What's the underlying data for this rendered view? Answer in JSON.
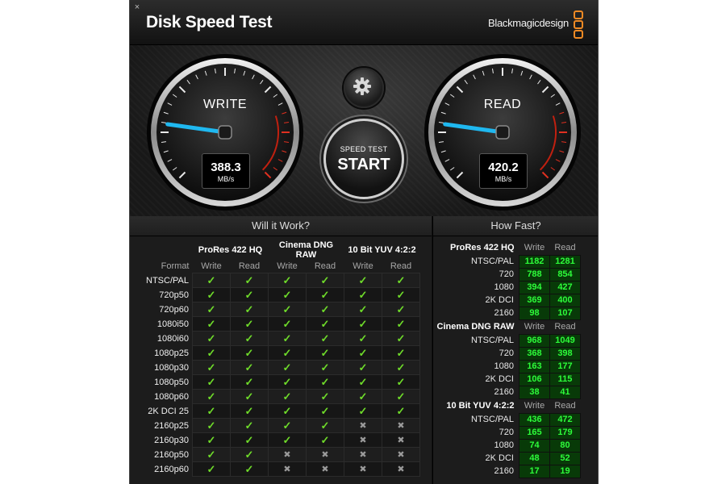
{
  "window": {
    "title": "Disk Speed Test",
    "brand": "Blackmagicdesign",
    "close_glyph": "×",
    "accent": "#f08a24"
  },
  "gauges": {
    "write": {
      "label": "WRITE",
      "value": "388.3",
      "unit": "MB/s",
      "needle_color": "#1fb8f0"
    },
    "read": {
      "label": "READ",
      "value": "420.2",
      "unit": "MB/s",
      "needle_color": "#1fb8f0"
    }
  },
  "controls": {
    "settings_icon": "gear-icon",
    "start_small": "SPEED TEST",
    "start_big": "START"
  },
  "will_it_work": {
    "title": "Will it Work?",
    "format_header": "Format",
    "groups": [
      "ProRes 422 HQ",
      "Cinema DNG RAW",
      "10 Bit YUV 4:2:2"
    ],
    "subheaders": [
      "Write",
      "Read"
    ],
    "rows": [
      {
        "format": "NTSC/PAL",
        "cells": [
          "ok",
          "ok",
          "ok",
          "ok",
          "ok",
          "ok"
        ]
      },
      {
        "format": "720p50",
        "cells": [
          "ok",
          "ok",
          "ok",
          "ok",
          "ok",
          "ok"
        ]
      },
      {
        "format": "720p60",
        "cells": [
          "ok",
          "ok",
          "ok",
          "ok",
          "ok",
          "ok"
        ]
      },
      {
        "format": "1080i50",
        "cells": [
          "ok",
          "ok",
          "ok",
          "ok",
          "ok",
          "ok"
        ]
      },
      {
        "format": "1080i60",
        "cells": [
          "ok",
          "ok",
          "ok",
          "ok",
          "ok",
          "ok"
        ]
      },
      {
        "format": "1080p25",
        "cells": [
          "ok",
          "ok",
          "ok",
          "ok",
          "ok",
          "ok"
        ]
      },
      {
        "format": "1080p30",
        "cells": [
          "ok",
          "ok",
          "ok",
          "ok",
          "ok",
          "ok"
        ]
      },
      {
        "format": "1080p50",
        "cells": [
          "ok",
          "ok",
          "ok",
          "ok",
          "ok",
          "ok"
        ]
      },
      {
        "format": "1080p60",
        "cells": [
          "ok",
          "ok",
          "ok",
          "ok",
          "ok",
          "ok"
        ]
      },
      {
        "format": "2K DCI 25",
        "cells": [
          "ok",
          "ok",
          "ok",
          "ok",
          "ok",
          "ok"
        ]
      },
      {
        "format": "2160p25",
        "cells": [
          "ok",
          "ok",
          "ok",
          "ok",
          "no",
          "no"
        ]
      },
      {
        "format": "2160p30",
        "cells": [
          "ok",
          "ok",
          "ok",
          "ok",
          "no",
          "no"
        ]
      },
      {
        "format": "2160p50",
        "cells": [
          "ok",
          "ok",
          "no",
          "no",
          "no",
          "no"
        ]
      },
      {
        "format": "2160p60",
        "cells": [
          "ok",
          "ok",
          "no",
          "no",
          "no",
          "no"
        ]
      }
    ]
  },
  "how_fast": {
    "title": "How Fast?",
    "write_header": "Write",
    "read_header": "Read",
    "groups": [
      {
        "name": "ProRes 422 HQ",
        "rows": [
          {
            "format": "NTSC/PAL",
            "write": "1182",
            "read": "1281"
          },
          {
            "format": "720",
            "write": "788",
            "read": "854"
          },
          {
            "format": "1080",
            "write": "394",
            "read": "427"
          },
          {
            "format": "2K DCI",
            "write": "369",
            "read": "400"
          },
          {
            "format": "2160",
            "write": "98",
            "read": "107"
          }
        ]
      },
      {
        "name": "Cinema DNG RAW",
        "rows": [
          {
            "format": "NTSC/PAL",
            "write": "968",
            "read": "1049"
          },
          {
            "format": "720",
            "write": "368",
            "read": "398"
          },
          {
            "format": "1080",
            "write": "163",
            "read": "177"
          },
          {
            "format": "2K DCI",
            "write": "106",
            "read": "115"
          },
          {
            "format": "2160",
            "write": "38",
            "read": "41"
          }
        ]
      },
      {
        "name": "10 Bit YUV 4:2:2",
        "rows": [
          {
            "format": "NTSC/PAL",
            "write": "436",
            "read": "472"
          },
          {
            "format": "720",
            "write": "165",
            "read": "179"
          },
          {
            "format": "1080",
            "write": "74",
            "read": "80"
          },
          {
            "format": "2K DCI",
            "write": "48",
            "read": "52"
          },
          {
            "format": "2160",
            "write": "17",
            "read": "19"
          }
        ]
      }
    ]
  }
}
